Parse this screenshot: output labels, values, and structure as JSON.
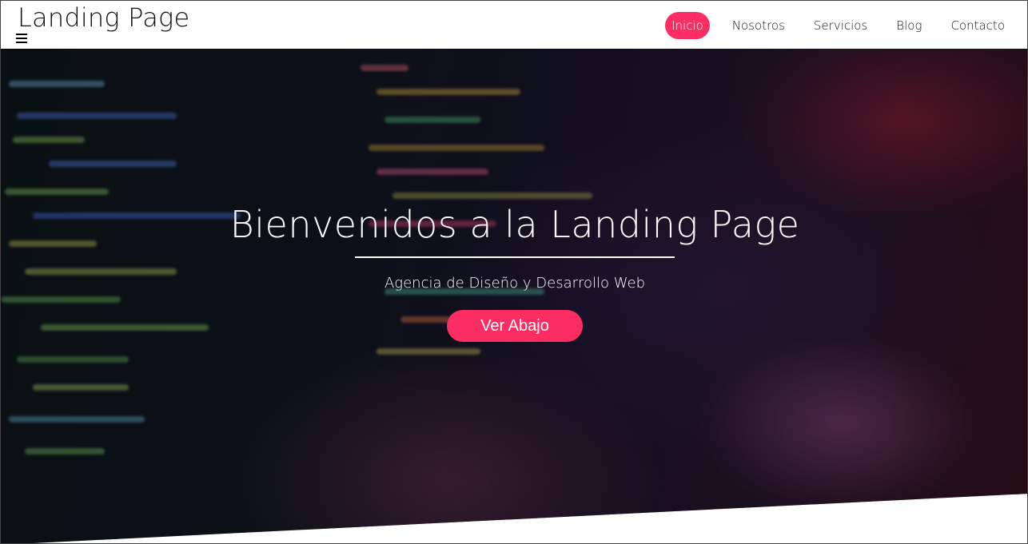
{
  "header": {
    "brand": "Landing Page",
    "menu_icon": "hamburger-menu-icon",
    "nav": [
      {
        "label": "Inicio",
        "active": true
      },
      {
        "label": "Nosotros",
        "active": false
      },
      {
        "label": "Servicios",
        "active": false
      },
      {
        "label": "Blog",
        "active": false
      },
      {
        "label": "Contacto",
        "active": false
      }
    ]
  },
  "hero": {
    "title": "Bienvenidos a la Landing Page",
    "subtitle": "Agencia de Diseño y Desarrollo Web",
    "cta_label": "Ver Abajo",
    "background_image": "developer-typing-code-at-screen"
  },
  "colors": {
    "accent": "#fc2d62",
    "header_bg": "#ffffff",
    "hero_text": "#ffffff"
  }
}
